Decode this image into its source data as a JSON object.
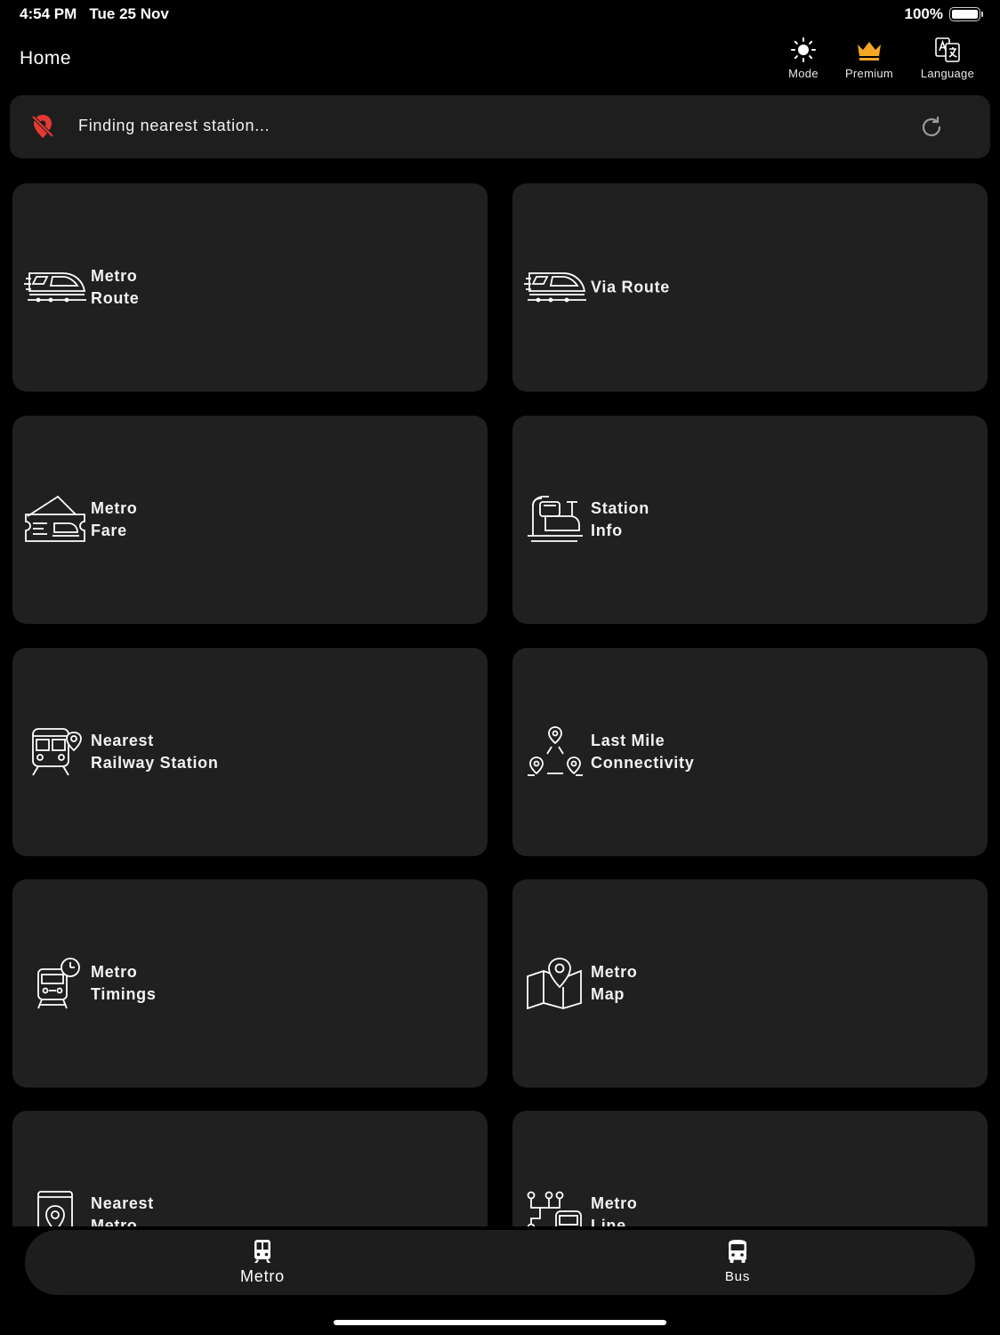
{
  "status_bar": {
    "time": "4:54 PM",
    "date": "Tue 25 Nov",
    "battery": "100%"
  },
  "header": {
    "title": "Home",
    "actions": [
      {
        "label": "Mode",
        "icon": "sun-icon"
      },
      {
        "label": "Premium",
        "icon": "crown-icon",
        "color": "#F5A623"
      },
      {
        "label": "Language",
        "icon": "translate-icon"
      }
    ]
  },
  "location_banner": {
    "text": "Finding nearest station...",
    "icon": "location-off-icon",
    "icon_color": "#E53935",
    "refresh_icon": "refresh-icon"
  },
  "cards": [
    {
      "lines": [
        "Metro",
        "Route"
      ],
      "icon": "metro-train-icon"
    },
    {
      "lines": [
        "Via Route"
      ],
      "icon": "metro-train-icon"
    },
    {
      "lines": [
        "Metro",
        "Fare"
      ],
      "icon": "ticket-icon"
    },
    {
      "lines": [
        "Station",
        "Info"
      ],
      "icon": "station-icon"
    },
    {
      "lines": [
        "Nearest",
        "Railway Station"
      ],
      "icon": "railway-location-icon"
    },
    {
      "lines": [
        "Last Mile",
        "Connectivity"
      ],
      "icon": "connectivity-icon"
    },
    {
      "lines": [
        "Metro",
        "Timings"
      ],
      "icon": "train-clock-icon"
    },
    {
      "lines": [
        "Metro",
        "Map"
      ],
      "icon": "map-pin-icon"
    },
    {
      "lines": [
        "Nearest",
        "Metro"
      ],
      "icon": "nearest-metro-icon"
    },
    {
      "lines": [
        "Metro",
        "Line"
      ],
      "icon": "metro-line-icon"
    }
  ],
  "bottom_nav": {
    "items": [
      {
        "label": "Metro",
        "icon": "metro-icon",
        "active": true
      },
      {
        "label": "Bus",
        "icon": "bus-icon",
        "active": false
      }
    ]
  },
  "colors": {
    "background": "#000000",
    "card": "#202020",
    "accent_premium": "#F5A623",
    "location_icon": "#E53935"
  }
}
